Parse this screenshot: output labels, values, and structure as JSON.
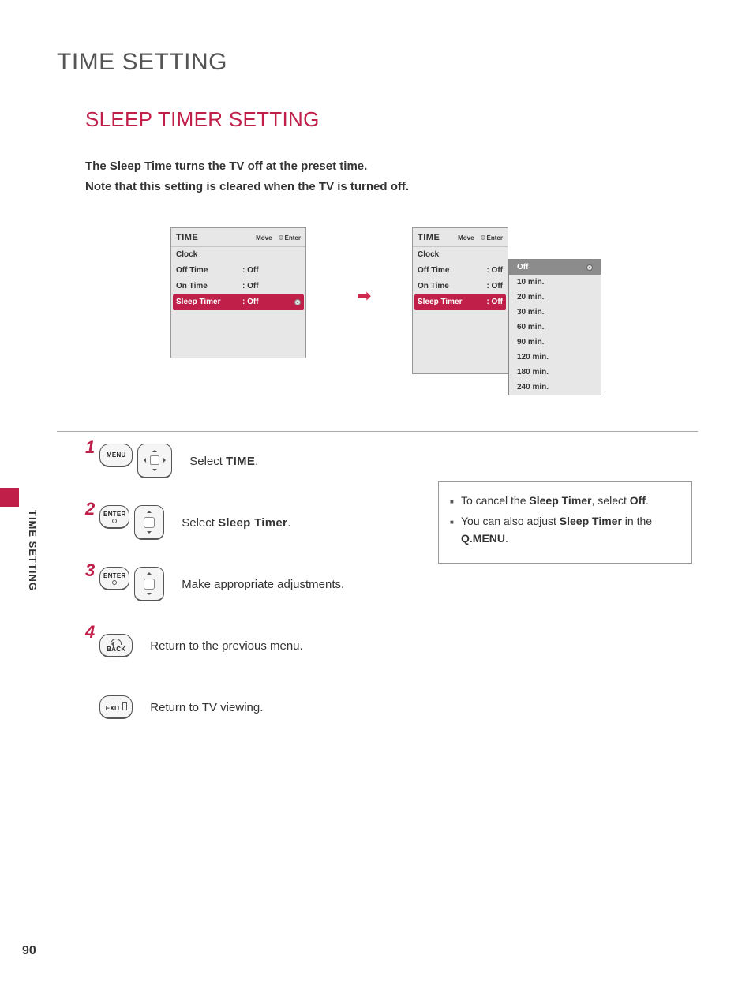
{
  "page_title": "TIME SETTING",
  "section_title": "SLEEP TIMER SETTING",
  "intro_line1": "The Sleep Time turns the TV off at the preset time.",
  "intro_line2": "Note that this setting is cleared when the TV is turned off.",
  "osd": {
    "title": "TIME",
    "hint_move": "Move",
    "hint_enter": "Enter",
    "rows": {
      "clock": {
        "label": "Clock",
        "value": ""
      },
      "off_time": {
        "label": "Off Time",
        "value": ": Off"
      },
      "on_time": {
        "label": "On Time",
        "value": ": Off"
      },
      "sleep_timer": {
        "label": "Sleep Timer",
        "value": ": Off"
      }
    }
  },
  "dropdown_options": [
    "Off",
    "10 min.",
    "20 min.",
    "30 min.",
    "60 min.",
    "90 min.",
    "120 min.",
    "180 min.",
    "240 min."
  ],
  "buttons": {
    "menu": "MENU",
    "enter": "ENTER",
    "back": "BACK",
    "exit": "EXIT"
  },
  "steps": {
    "s1_prefix": "Select ",
    "s1_bold": "TIME",
    "s1_suffix": ".",
    "s2_prefix": "Select ",
    "s2_bold": "Sleep Timer",
    "s2_suffix": ".",
    "s3": "Make appropriate adjustments.",
    "s4": "Return to the previous menu.",
    "s5": "Return to TV viewing."
  },
  "notes": {
    "n1_a": "To cancel the ",
    "n1_b": "Sleep Timer",
    "n1_c": ", select ",
    "n1_d": "Off",
    "n1_e": ".",
    "n2_a": "You can also adjust ",
    "n2_b": "Sleep Timer",
    "n2_c": " in the ",
    "n2_d": "Q.MENU",
    "n2_e": "."
  },
  "side_label": "TIME SETTING",
  "page_number": "90"
}
